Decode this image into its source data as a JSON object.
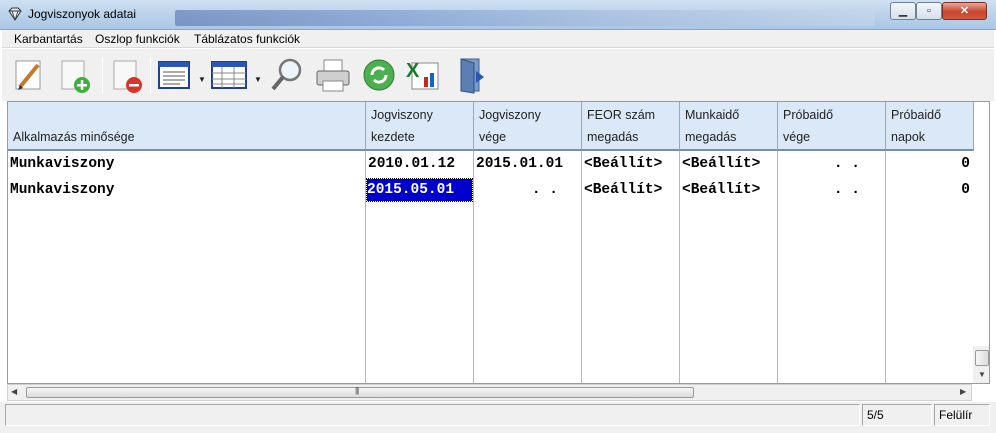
{
  "window": {
    "title": "Jogviszonyok adatai"
  },
  "menu": [
    "Karbantartás",
    "Oszlop funkciók",
    "Táblázatos funkciók"
  ],
  "toolbar": [
    {
      "name": "edit-pencil-icon"
    },
    {
      "name": "add-record-icon"
    },
    {
      "name": "delete-record-icon"
    },
    {
      "name": "form-view-icon"
    },
    {
      "name": "table-view-icon"
    },
    {
      "name": "search-magnifier-icon"
    },
    {
      "name": "print-icon"
    },
    {
      "name": "refresh-icon"
    },
    {
      "name": "excel-export-icon"
    },
    {
      "name": "exit-door-icon"
    }
  ],
  "grid": {
    "columns": [
      {
        "l1": "",
        "l2": "Alkalmazás minősége"
      },
      {
        "l1": "Jogviszony",
        "l2": "kezdete"
      },
      {
        "l1": "Jogviszony",
        "l2": "vége"
      },
      {
        "l1": "FEOR szám",
        "l2": "megadás"
      },
      {
        "l1": "Munkaidő",
        "l2": "megadás"
      },
      {
        "l1": "Próbaidő",
        "l2": "vége"
      },
      {
        "l1": "Próbaidő",
        "l2": "napok"
      }
    ],
    "rows": [
      [
        "Munkaviszony",
        "2010.01.12",
        "2015.01.01",
        "<Beállít>",
        "<Beállít>",
        ".  .",
        "0"
      ],
      [
        "Munkaviszony",
        "2015.05.01",
        ".  .",
        "<Beállít>",
        "<Beállít>",
        ".  .",
        "0"
      ]
    ],
    "selected": {
      "row": 1,
      "col": 1
    }
  },
  "status": {
    "record": "5/5",
    "mode": "Felülír"
  },
  "colors": {
    "header_bg": "#dbe8f8",
    "selection": "#0000cc"
  }
}
